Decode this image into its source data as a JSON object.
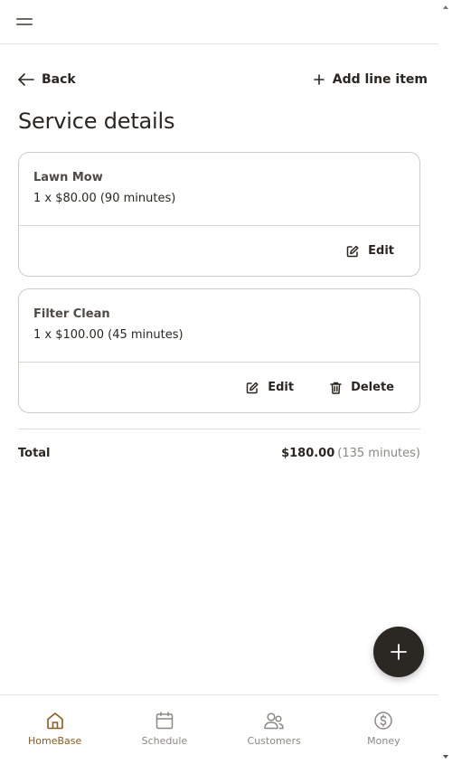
{
  "header": {
    "menu_icon": "hamburger-icon"
  },
  "actions": {
    "back_label": "Back",
    "add_label": "Add line item"
  },
  "page": {
    "title": "Service details"
  },
  "line_items": [
    {
      "name": "Lawn Mow",
      "detail": "1 x $80.00 (90 minutes)",
      "edit_label": "Edit"
    },
    {
      "name": "Filter Clean",
      "detail": "1 x $100.00 (45 minutes)",
      "edit_label": "Edit",
      "delete_label": "Delete"
    }
  ],
  "total": {
    "label": "Total",
    "amount": "$180.00",
    "minutes": "(135 minutes)"
  },
  "nav": {
    "items": [
      {
        "label": "HomeBase",
        "icon": "home-icon",
        "active": true
      },
      {
        "label": "Schedule",
        "icon": "calendar-icon",
        "active": false
      },
      {
        "label": "Customers",
        "icon": "customers-icon",
        "active": false
      },
      {
        "label": "Money",
        "icon": "dollar-icon",
        "active": false
      }
    ]
  },
  "colors": {
    "accent": "#8a5a1e",
    "text": "#2b2621",
    "muted": "#8c8884",
    "fab": "#2b2824",
    "border": "#cfccc8"
  }
}
